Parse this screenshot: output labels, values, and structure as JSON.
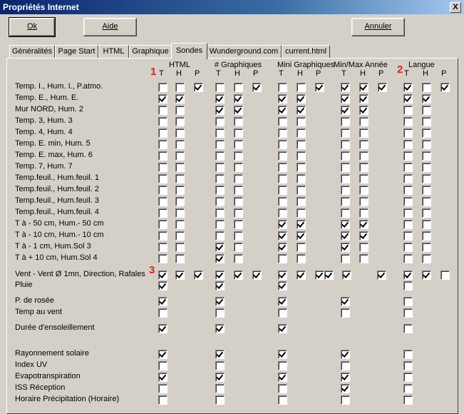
{
  "window": {
    "title": "Propriétés Internet",
    "close_glyph": "X"
  },
  "buttons": {
    "ok": "Ok",
    "aide": "Aide",
    "annuler": "Annuler"
  },
  "tabs": [
    "Généralités",
    "Page Start",
    "HTML",
    "Graphique",
    "Sondes",
    "Wunderground.com",
    "current.html"
  ],
  "active_tab": "Sondes",
  "groups": [
    "HTML",
    "# Graphiques",
    "Mini Graphiques",
    "Min/Max Année",
    "Langue"
  ],
  "subcols": [
    "T",
    "H",
    "P"
  ],
  "markers": {
    "one": "1",
    "two": "2",
    "three": "3"
  },
  "rows": [
    "Temp. I., Hum. I., P.atmo.",
    "Temp. E., Hum. E.",
    "Mur NORD, Hum. 2",
    "Temp. 3, Hum. 3",
    "Temp. 4, Hum. 4",
    "Temp. E. min, Hum. 5",
    "Temp. E. max, Hum. 6",
    "Temp. 7, Hum. 7",
    "Temp.feuil., Hum.feuil. 1",
    "Temp.feuil., Hum.feuil. 2",
    "Temp.feuil., Hum.feuil. 3",
    "Temp.feuil., Hum.feuil. 4",
    "T à - 50 cm, Hum.- 50 cm",
    "T à - 10 cm, Hum.- 10 cm",
    "T à - 1 cm, Hum.Sol 3",
    "T à + 10 cm, Hum.Sol 4",
    "Vent - Vent Ø 1mn, Direction, Rafales",
    "Pluie",
    "P. de rosée",
    "Temp au vent",
    "Durée d'ensoleillement",
    "Rayonnement solaire",
    "Index UV",
    "Evapotranspiration",
    "ISS Réception",
    "Horaire Précipitation (Horaire)"
  ]
}
